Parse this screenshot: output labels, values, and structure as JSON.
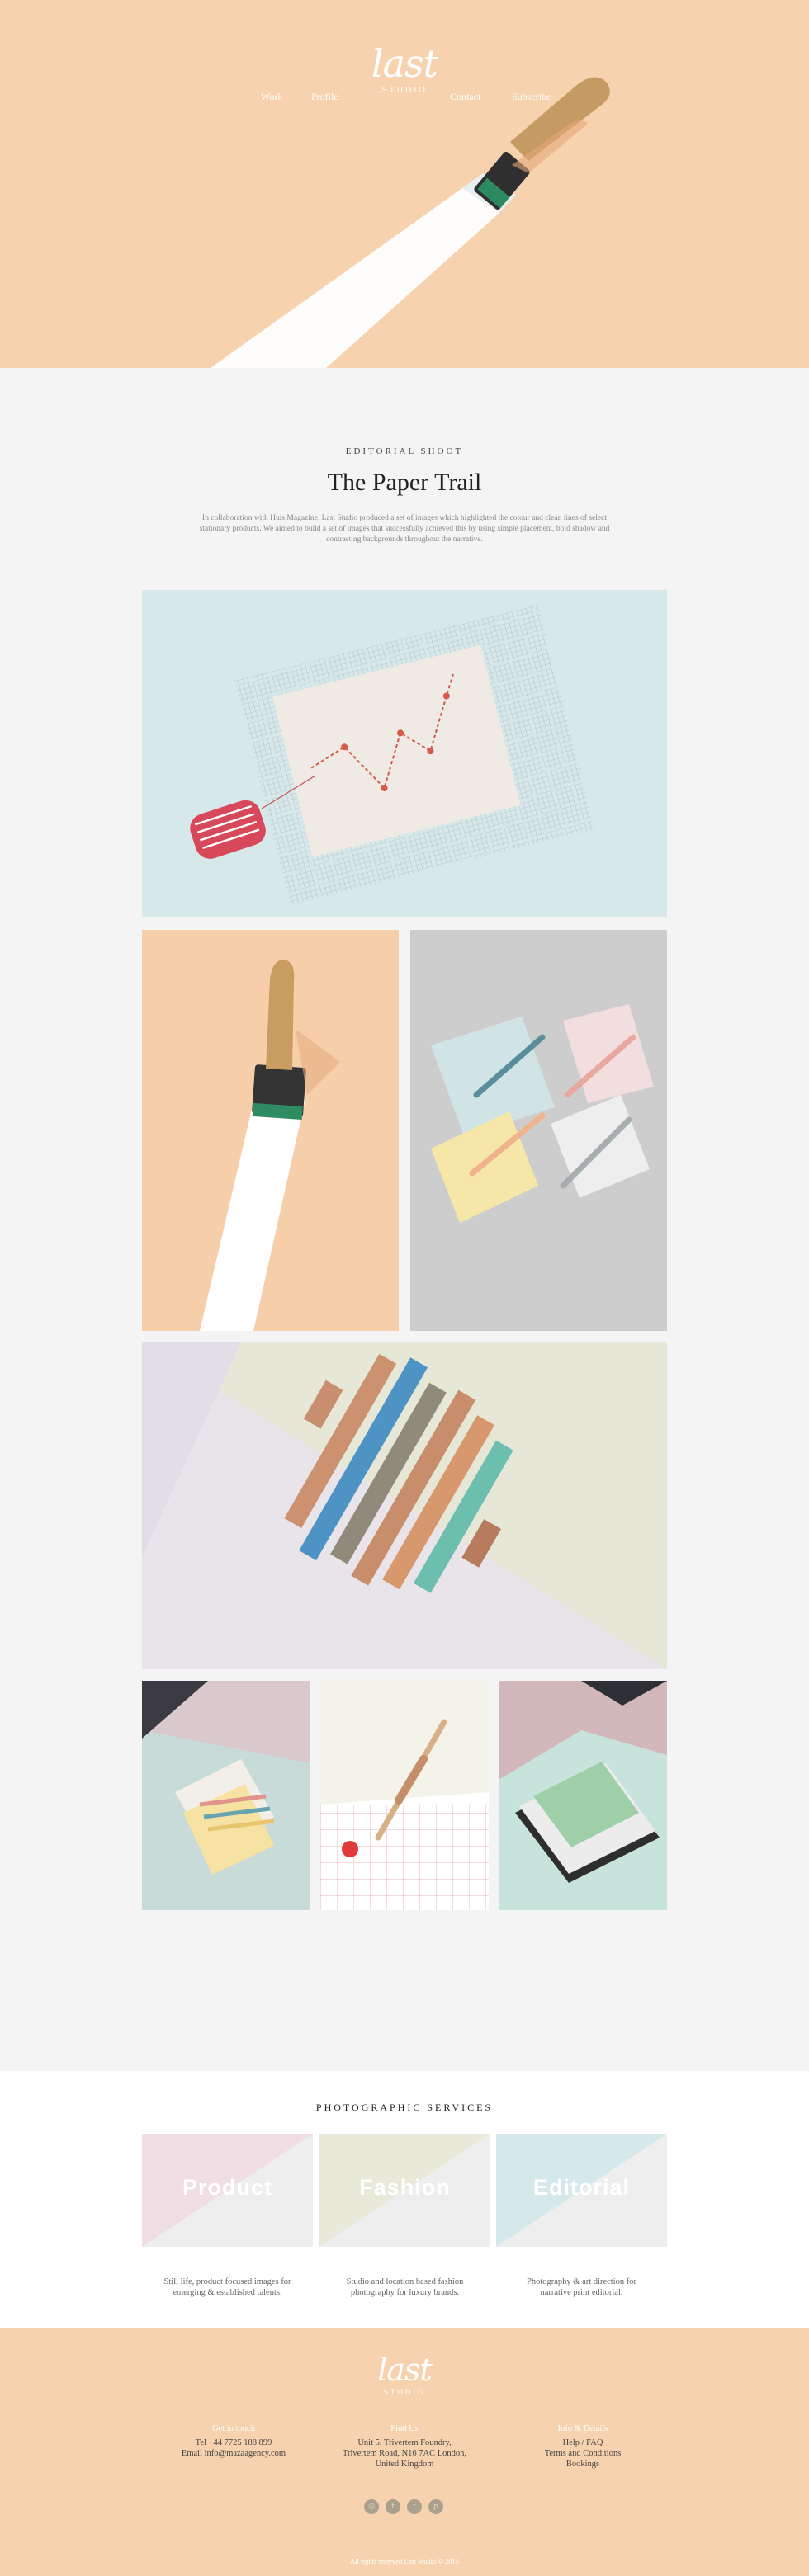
{
  "brand": {
    "logo_script": "last",
    "logo_sub": "STUDIO"
  },
  "nav": [
    "Work",
    "Profile",
    "Contact",
    "Subscribe"
  ],
  "editorial": {
    "eyebrow": "EDITORIAL SHOOT",
    "title": "The Paper Trail",
    "description": "In collaboration with Huis Magazine, Last Studio produced a set of images which highlighted the colour and clean lines of select stationary products. We aimed to build a set of images that successfully achieved this by using simple placement, bold shadow and contrasting backgrounds throughout the narrative."
  },
  "photos": [
    {
      "name": "photo-grid-notepad",
      "bg": "#d7e8ea"
    },
    {
      "name": "photo-paintbrush",
      "bg": "#f7ceaa"
    },
    {
      "name": "photo-pens-cards",
      "bg": "#cdcdcd"
    },
    {
      "name": "photo-rulers",
      "bg": "#e7e7d8"
    },
    {
      "name": "photo-pencils-stack",
      "bg": "#c9dbd9"
    },
    {
      "name": "photo-fountain-pen",
      "bg": "#f4f3ea"
    },
    {
      "name": "photo-notebooks",
      "bg": "#c7e3dc"
    }
  ],
  "services": {
    "title": "PHOTOGRAPHIC SERVICES",
    "items": [
      {
        "label": "Product",
        "desc_line1": "Still life, product focused images for",
        "desc_line2": "emerging & established talents.",
        "color": "#f1dde4"
      },
      {
        "label": "Fashion",
        "desc_line1": "Studio and location based fashion",
        "desc_line2": "photography for luxury brands.",
        "color": "#e9e9d9"
      },
      {
        "label": "Editorial",
        "desc_line1": "Photography & art direction for",
        "desc_line2": "narrative print editorial.",
        "color": "#d6e9ea"
      }
    ]
  },
  "footer": {
    "col1": {
      "head": "Get in touch",
      "line1": "Tel +44 7725 188 899",
      "line2": "Email info@mazaagency.com"
    },
    "col2": {
      "head": "Find Us",
      "line1": "Unit 5, Trivertem Foundry,",
      "line2": "Trivertem Road, N16 7AC London,",
      "line3": "United Kingdom"
    },
    "col3": {
      "head": "Info & Details",
      "line1": "Help / FAQ",
      "line2": "Terms and Conditions",
      "line3": "Bookings"
    },
    "socials": [
      "instagram-icon",
      "facebook-icon",
      "twitter-icon",
      "pinterest-icon"
    ],
    "social_glyphs": [
      "◎",
      "f",
      "t",
      "p"
    ],
    "copyright": "All rights reserved Last Studio © 2015"
  },
  "colors": {
    "peach": "#f7d2ae",
    "page_bg": "#f4f4f4",
    "white": "#ffffff"
  }
}
